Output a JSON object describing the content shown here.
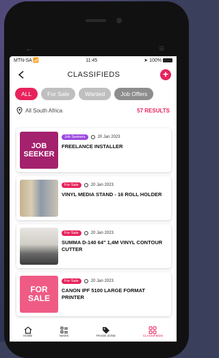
{
  "status": {
    "carrier": "MTN-SA",
    "time": "11:45",
    "battery": "100%"
  },
  "header": {
    "title": "CLASSIFIEDS"
  },
  "filters": [
    {
      "label": "ALL"
    },
    {
      "label": "For Sale"
    },
    {
      "label": "Wanted"
    },
    {
      "label": "Job Offers"
    }
  ],
  "location": {
    "label": "All South Africa",
    "results": "57 RESULTS"
  },
  "listings": [
    {
      "thumb_text": "JOB SEEKER",
      "badge": "Job Seekers",
      "date": "20 Jan 2023",
      "title": "FREELANCE INSTALLER"
    },
    {
      "badge": "For Sale",
      "date": "20 Jan 2023",
      "title": "VINYL MEDIA STAND - 16 ROLL HOLDER"
    },
    {
      "badge": "For Sale",
      "date": "20 Jan 2023",
      "title": "SUMMA D-140 64\" 1,4M VINYL CONTOUR CUTTER"
    },
    {
      "thumb_text": "FOR SALE",
      "badge": "For Sale",
      "date": "20 Jan 2023",
      "title": "CANON IPF 5100 LARGE FORMAT PRINTER"
    }
  ],
  "tabs": [
    {
      "label": "HOME",
      "icon": "home-icon"
    },
    {
      "label": "NEWS",
      "icon": "news-icon"
    },
    {
      "label": "TRADE ZONE",
      "icon": "tag-icon"
    },
    {
      "label": "CLASSIFIEDS",
      "icon": "grid-icon"
    }
  ],
  "colors": {
    "accent": "#e8225c",
    "job_badge": "#9b48e0"
  }
}
